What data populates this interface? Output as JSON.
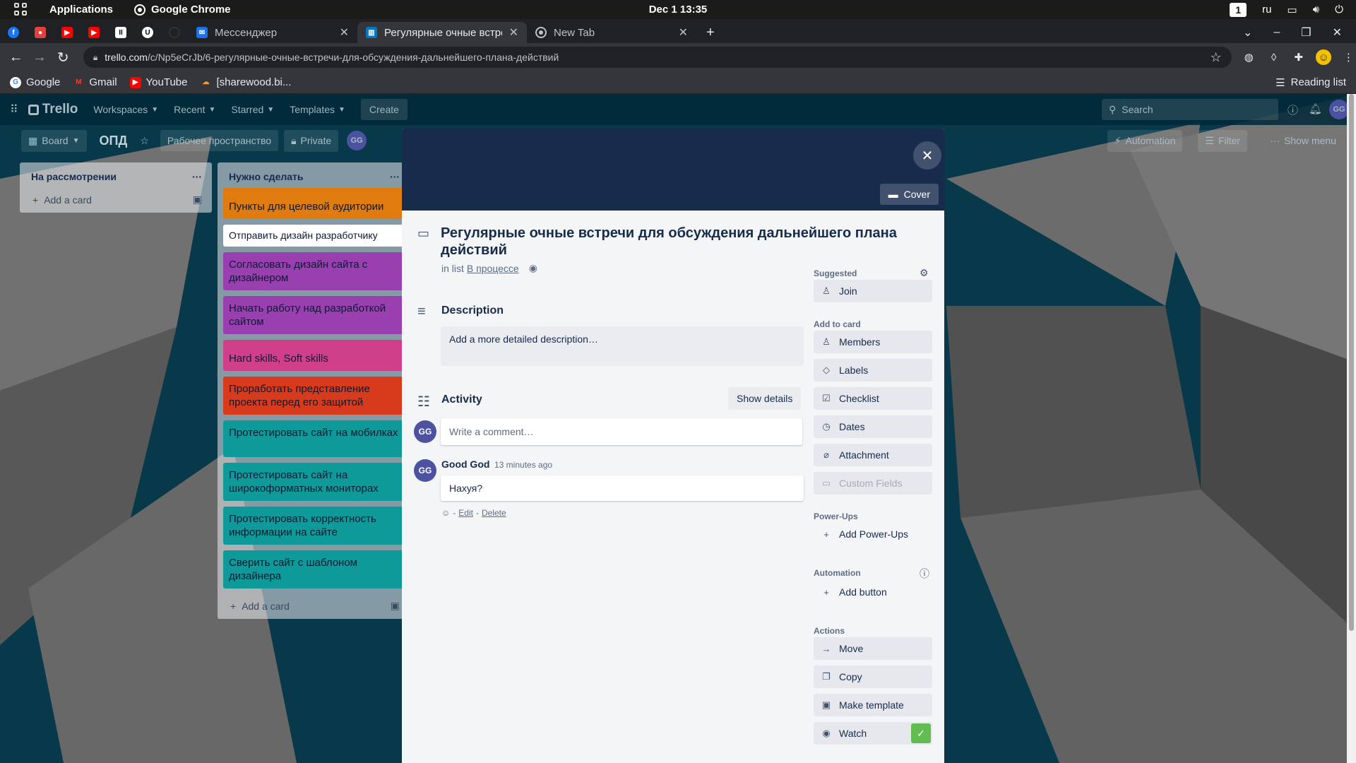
{
  "os_bar": {
    "applications": "Applications",
    "chrome_label": "Google Chrome",
    "clock": "Dec 1  13:35",
    "workspace": "1",
    "lang": "ru"
  },
  "tabs": {
    "messenger": "Мессенджер",
    "trello": "Регулярные очные встре",
    "newtab": "New Tab"
  },
  "address": {
    "host": "trello.com",
    "path": "/c/Np5eCrJb/6-регулярные-очные-встречи-для-обсуждения-дальнейшего-плана-действий"
  },
  "bookmarks": {
    "items": [
      "Google",
      "Gmail",
      "YouTube",
      "[sharewood.bi..."
    ],
    "reading_list": "Reading list"
  },
  "trello_header": {
    "logo": "Trello",
    "menus": [
      "Workspaces",
      "Recent",
      "Starred",
      "Templates"
    ],
    "create": "Create",
    "search_placeholder": "Search"
  },
  "board_bar": {
    "view": "Board",
    "title": "ОПД",
    "workspace": "Рабочее пространство",
    "visibility": "Private",
    "member": "GG",
    "automation": "Automation",
    "filter": "Filter",
    "show_menu": "Show menu"
  },
  "lists": [
    {
      "title": "На рассмотрении",
      "add": "Add a card",
      "cards": []
    },
    {
      "title": "Нужно сделать",
      "add": "Add a card",
      "cards": [
        "Пункты для целевой аудитории",
        "Отправить дизайн разработчику",
        "Согласовать дизайн сайта с дизайнером",
        "Начать работу над разработкой сайтом",
        "Hard skills, Soft skills",
        "Проработать представление проекта перед его защитой",
        "Протестировать сайт на мобилках",
        "Протестировать сайт на широкоформатных мониторах",
        "Протестировать корректность информации на сайте",
        "Сверить сайт с шаблоном дизайнера"
      ]
    }
  ],
  "card_colors": [
    "#e07b10",
    "#ffffff",
    "#9a3fb0",
    "#9a3fb0",
    "#d0408a",
    "#d83a1c",
    "#0f9a9a",
    "#0f9a9a",
    "#0f9a9a",
    "#0f9a9a"
  ],
  "modal": {
    "cover_button": "Cover",
    "title": "Регулярные очные встречи для обсуждения дальнейшего плана действий",
    "in_list_prefix": "in list",
    "list_name": "В процессе",
    "description_title": "Description",
    "description_placeholder": "Add a more detailed description…",
    "activity_title": "Activity",
    "show_details": "Show details",
    "comment_placeholder": "Write a comment…",
    "avatar_initials": "GG",
    "comment": {
      "author": "Good God",
      "time": "13 minutes ago",
      "text": "Нахуя?",
      "edit": "Edit",
      "delete": "Delete"
    }
  },
  "sidebar": {
    "suggested": "Suggested",
    "join": "Join",
    "add_to_card": "Add to card",
    "members": "Members",
    "labels": "Labels",
    "checklist": "Checklist",
    "dates": "Dates",
    "attachment": "Attachment",
    "custom_fields": "Custom Fields",
    "power_ups": "Power-Ups",
    "add_power_ups": "Add Power-Ups",
    "automation": "Automation",
    "add_button": "Add button",
    "actions": "Actions",
    "move": "Move",
    "copy": "Copy",
    "make_template": "Make template",
    "watch": "Watch"
  },
  "colors": {
    "modal_cover": "#172b4d",
    "accent_blue": "#0f6d8f",
    "watch_check": "#61bd4f"
  }
}
